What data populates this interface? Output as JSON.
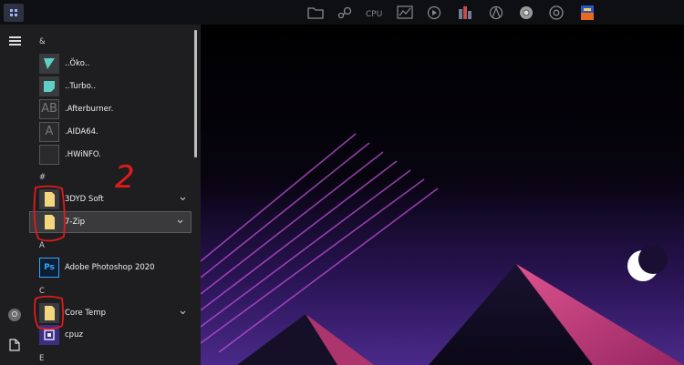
{
  "start_menu": {
    "sections": [
      {
        "letter": "&",
        "items": [
          {
            "label": "..Öko..",
            "icon": "teal-shape-icon"
          },
          {
            "label": "..Turbo..",
            "icon": "teal-shape-icon"
          },
          {
            "label": ".Afterburner.",
            "icon": "ab-placeholder-icon",
            "glyph": "AB"
          },
          {
            "label": ".AIDA64.",
            "icon": "a-placeholder-icon",
            "glyph": "A"
          },
          {
            "label": ".HWiNFO.",
            "icon": "placeholder-icon",
            "glyph": ""
          }
        ]
      },
      {
        "letter": "#",
        "items": [
          {
            "label": "3DYD Soft",
            "icon": "folder-icon",
            "expandable": true
          },
          {
            "label": "7-Zip",
            "icon": "folder-icon",
            "expandable": true,
            "highlighted": true
          }
        ]
      },
      {
        "letter": "A",
        "items": [
          {
            "label": "Adobe Photoshop 2020",
            "icon": "photoshop-icon",
            "glyph": "Ps"
          }
        ]
      },
      {
        "letter": "C",
        "items": [
          {
            "label": "Core Temp",
            "icon": "folder-icon",
            "expandable": true
          },
          {
            "label": "cpuz",
            "icon": "cpuz-icon"
          }
        ]
      },
      {
        "letter": "E",
        "items": []
      }
    ]
  },
  "taskbar": {
    "tray_icons": [
      "folder-icon",
      "steam-icon",
      "cpu-icon",
      "monitor-graph-icon",
      "media-icon",
      "bar-chart-icon",
      "aida-icon",
      "chrome-alt-icon",
      "chrome-icon",
      "colorful-app-icon"
    ],
    "cpu_label": "CPU"
  },
  "annotation": {
    "text": "2"
  },
  "colors": {
    "menu_bg": "#1e1e20",
    "taskbar_bg": "#0e0f13",
    "folder": "#f4d77c",
    "accent_pink": "#e8457a",
    "accent_purple": "#5a2a8a"
  }
}
